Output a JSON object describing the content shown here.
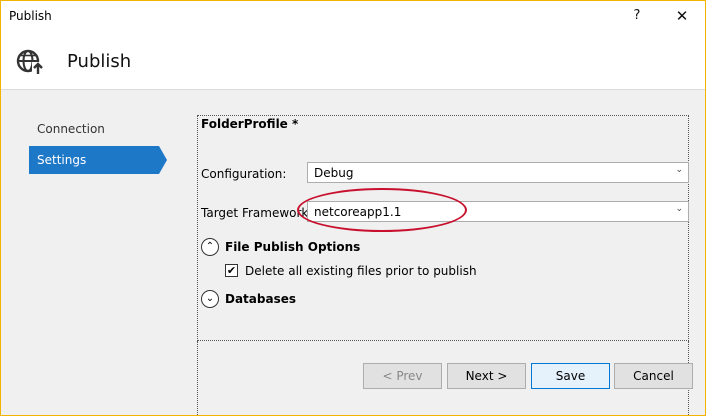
{
  "window": {
    "title": "Publish",
    "help_glyph": "?",
    "close_glyph": "✕"
  },
  "header": {
    "title": "Publish",
    "icon": "globe-publish-icon"
  },
  "nav": {
    "items": [
      {
        "label": "Connection",
        "selected": false
      },
      {
        "label": "Settings",
        "selected": true
      }
    ]
  },
  "settings": {
    "profile_title": "FolderProfile *",
    "configuration": {
      "label": "Configuration:",
      "value": "Debug",
      "chevron": "⌄"
    },
    "target_framework": {
      "label": "Target Framework:",
      "value": "netcoreapp1.1",
      "chevron": "⌄"
    },
    "file_publish_options": {
      "label": "File Publish Options",
      "toggle_glyph": "⌃",
      "expanded": true,
      "delete_existing": {
        "label": "Delete all existing files prior to publish",
        "checked": true,
        "check_glyph": "✔"
      }
    },
    "databases": {
      "label": "Databases",
      "toggle_glyph": "⌄",
      "expanded": false
    }
  },
  "buttons": {
    "prev": "< Prev",
    "next": "Next >",
    "save": "Save",
    "cancel": "Cancel"
  },
  "colors": {
    "accent": "#1e78c8",
    "window_border": "#f3b400",
    "highlight": "#c8102e"
  }
}
